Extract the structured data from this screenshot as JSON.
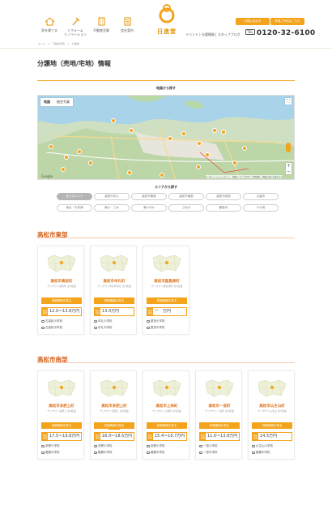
{
  "header": {
    "nav": [
      {
        "label": "家を建てる",
        "icon": "house-icon"
      },
      {
        "label": "リフォーム\nリノベーション",
        "icon": "hammer-icon"
      },
      {
        "label": "不動産売買",
        "icon": "building-icon"
      },
      {
        "label": "会社案内",
        "icon": "document-icon"
      }
    ],
    "logo_text": "日進堂",
    "buttons": [
      "お問い合わせ",
      "来場ご予約はこちら"
    ],
    "links": "イベント | 分譲情報 | スタッフブログ",
    "phone_label": "TEL",
    "phone": "0120-32-6100",
    "breadcrumb": "ホーム　＞　不動産売買　＞　分譲地"
  },
  "page": {
    "title": "分譲地（売地/宅地）情報",
    "map_label": "地図から探す",
    "area_label": "エリアから探す"
  },
  "map": {
    "tabs": [
      "地図",
      "航空写真"
    ],
    "zoom_in": "+",
    "zoom_out": "−",
    "fullscreen": "⛶",
    "google": "Google",
    "attribution": "キーボード ショートカット　地図データ ©2023　利用規約　地図の誤りを報告する"
  },
  "areas": [
    "全てのエリア",
    "高松市中心",
    "高松市東部",
    "高松市南部",
    "高松市西部",
    "丸亀市",
    "坂出・宇多津",
    "綾川・三木",
    "東かがわ",
    "さぬき",
    "観音寺",
    "その他"
  ],
  "sections": [
    {
      "title": "高松市東部",
      "cards": [
        {
          "name": "高松市高松町",
          "sub": "サンタウン高松町 全5区画",
          "badge": "",
          "btn": "詳細情報を見る",
          "price_tag": "販売価格",
          "price": "12.0〜13.8万円",
          "schools": [
            "古高松小学校",
            "古高松中学校"
          ]
        },
        {
          "name": "高松市牟礼町",
          "sub": "サンタウン牟礼町牟礼 全5区画",
          "badge": "",
          "btn": "詳細情報を見る",
          "price_tag": "販売価格",
          "price": "13.0万円",
          "schools": [
            "牟礼小学校",
            "牟礼中学校"
          ]
        },
        {
          "name": "高松市屋島東町",
          "sub": "サンタウン屋島東町 全5区画",
          "badge": "",
          "btn": "詳細情報を見る",
          "price_tag": "販売価格",
          "price": "一　万円",
          "schools": [
            "屋島小学校",
            "屋島中学校"
          ]
        }
      ]
    },
    {
      "title": "高松市南部",
      "cards": [
        {
          "name": "高松市多肥上町",
          "sub": "サンタウン多肥上 全8区画",
          "badge": "",
          "btn": "詳細情報を見る",
          "price_tag": "販売価格",
          "price": "17.5〜19.8万円",
          "schools": [
            "多肥小学校",
            "龍雲中学校"
          ]
        },
        {
          "name": "高松市多肥上町",
          "sub": "サンタウン多肥上 全6区画",
          "badge": "残り1区画",
          "btn": "詳細情報を見る",
          "price_tag": "販売価格",
          "price": "16.0〜18.5万円",
          "schools": [
            "多肥小学校",
            "龍雲中学校"
          ]
        },
        {
          "name": "高松市上林町",
          "sub": "サンタウン上林町 全6区画",
          "badge": "",
          "btn": "詳細情報を見る",
          "price_tag": "販売価格",
          "price": "15.4〜16.7万円",
          "schools": [
            "多肥小学校",
            "龍雲中学校"
          ]
        },
        {
          "name": "高松市一宮町",
          "sub": "サンタウン一宮町 全5区画",
          "badge": "",
          "btn": "詳細情報を見る",
          "price_tag": "販売価格",
          "price": "11.0〜13.8万円",
          "schools": [
            "一宮小学校",
            "一宮中学校"
          ]
        },
        {
          "name": "高松市仏生山町",
          "sub": "サンタウン仏生山 全5区画",
          "badge": "",
          "btn": "詳細情報を見る",
          "price_tag": "販売価格",
          "price": "14.5万円",
          "schools": [
            "仏生山小学校",
            "龍雲中学校"
          ]
        }
      ]
    }
  ],
  "colors": {
    "accent": "#f3a41c",
    "section_title": "#d3601b"
  }
}
